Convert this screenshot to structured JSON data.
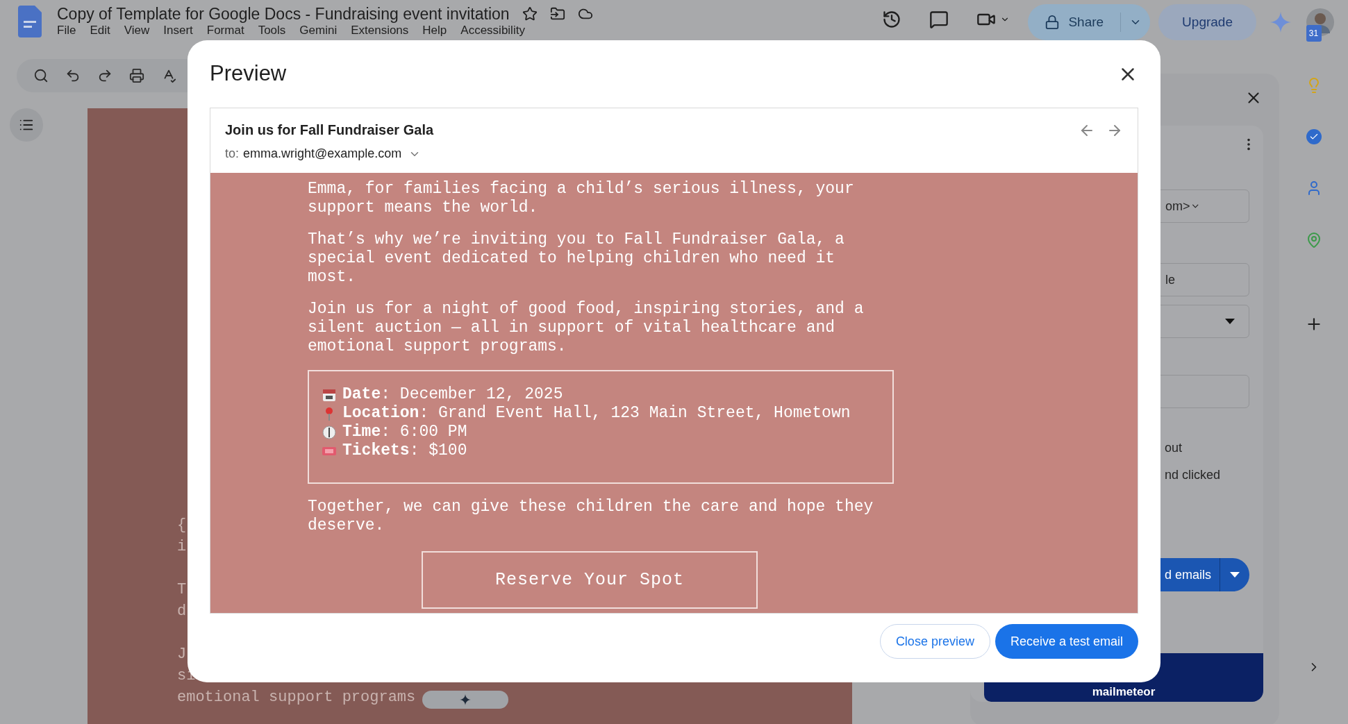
{
  "document": {
    "title": "Copy of Template for Google Docs - Fundraising event invitation",
    "menu": [
      "File",
      "Edit",
      "View",
      "Insert",
      "Format",
      "Tools",
      "Gemini",
      "Extensions",
      "Help",
      "Accessibility"
    ],
    "share_label": "Share",
    "upgrade_label": "Upgrade",
    "calendar_day": "31"
  },
  "doc_page": {
    "paragraphs": [
      [
        "{",
        "i"
      ],
      [
        "T",
        "d"
      ],
      [
        "J",
        "si",
        "emotional support programs"
      ]
    ]
  },
  "side_panel": {
    "from_field": "om>",
    "field_2": "le",
    "option_1": "out",
    "option_2": "nd clicked",
    "send_label": "d emails",
    "brand": "mailmeteor"
  },
  "preview": {
    "title": "Preview",
    "email": {
      "subject": "Join us for Fall Fundraiser Gala",
      "to_label": "to:",
      "to": "emma.wright@example.com",
      "paragraphs": [
        "Emma, for families facing a child’s serious illness, your support means the world.",
        "That’s why we’re inviting you to Fall Fundraiser Gala, a special event dedicated to helping children who need it most.",
        "Join us for a night of good food, inspiring stories, and a silent auction — all in support of vital healthcare and emotional support programs."
      ],
      "details": [
        {
          "kind": "calendar",
          "text": "**Date**: December 12, 2025"
        },
        {
          "kind": "pin",
          "text": "**Location**: Grand Event Hall, 123 Main Street, Hometown"
        },
        {
          "kind": "clock",
          "text": "**Time**: 6:00 PM"
        },
        {
          "kind": "ticket",
          "text": "**Tickets**: $100"
        }
      ],
      "closing": "Together, we can give these children the care and hope they deserve.",
      "cta": "Reserve Your Spot"
    },
    "buttons": [
      {
        "kind": "secondary",
        "label": "Close preview"
      },
      {
        "kind": "primary",
        "label": "Receive a test email"
      }
    ]
  }
}
